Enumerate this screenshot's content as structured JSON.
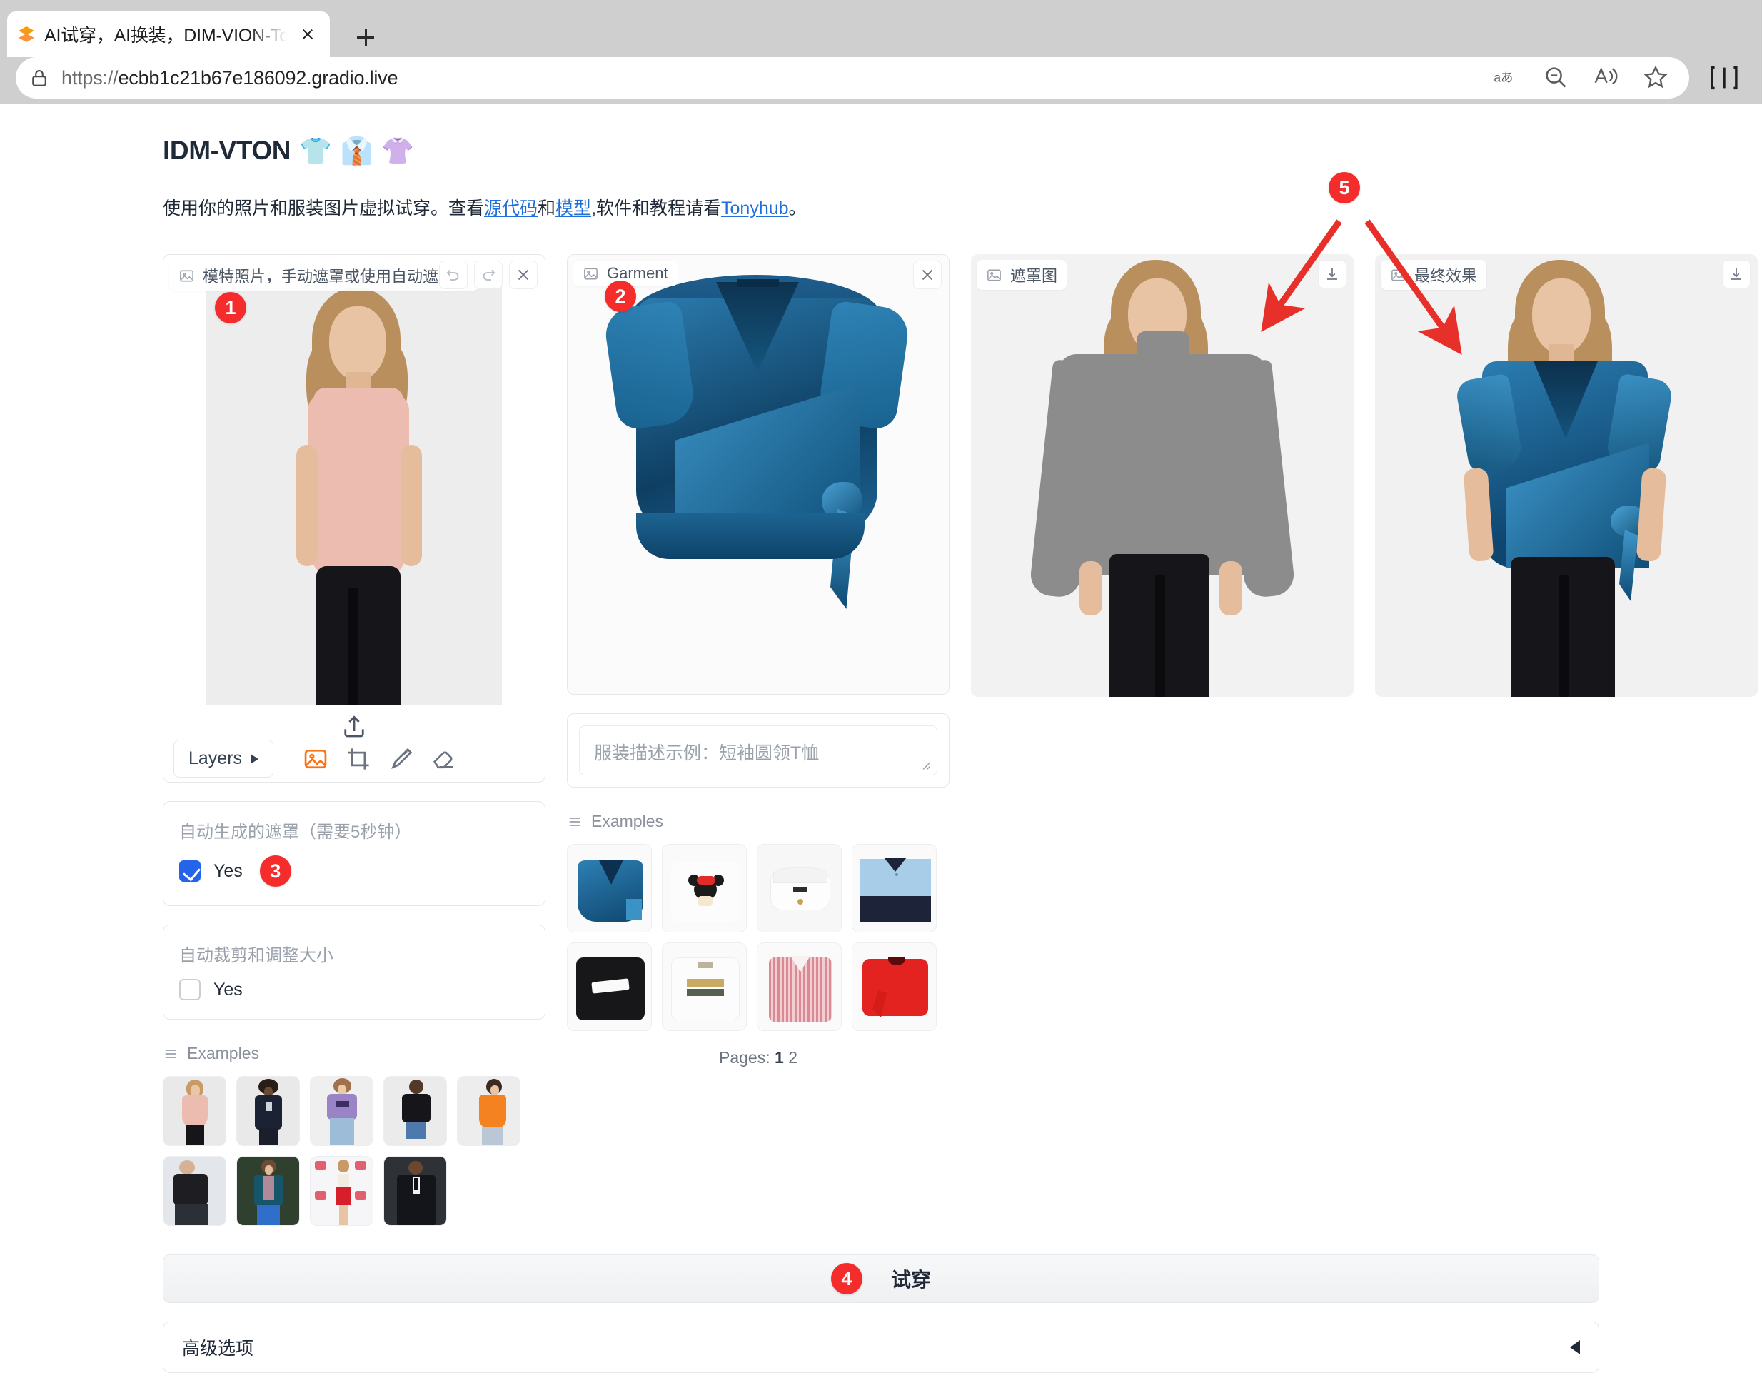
{
  "browser": {
    "tab": {
      "title": "AI试穿，AI换装，DIM-VION-Ton",
      "favicon": "gradio-logo-icon"
    },
    "new_tab_label": "+",
    "url": "https://ecbb1c21b67e186092.gradio.live",
    "url_scheme": "https://",
    "url_host": "ecbb1c21b67e186092.gradio.live",
    "toolbar_icons": [
      "translate-icon",
      "zoom-out-icon",
      "read-aloud-icon",
      "favorite-star-icon",
      "split-screen-icon"
    ]
  },
  "header": {
    "title": "IDM-VTON",
    "title_emojis": [
      "👕",
      "👔",
      "👚"
    ],
    "description_parts": {
      "lead": "使用你的照片和服装图片虚拟试穿。查看",
      "link_source": "源代码",
      "mid1": "和",
      "link_model": "模型",
      "mid2": ",软件和教程请看",
      "link_tonyhub": "Tonyhub",
      "tail": "。"
    }
  },
  "model_panel": {
    "label": "模特照片，手动遮罩或使用自动遮罩。",
    "icon": "picture-icon",
    "tools": [
      "undo-icon",
      "redo-icon",
      "close-icon"
    ],
    "editor": {
      "upload_icon": "upload-icon",
      "layers_label": "Layers",
      "tools": [
        "image-tool-icon",
        "crop-tool-icon",
        "brush-tool-icon",
        "eraser-tool-icon"
      ],
      "active_tool": "image-tool-icon"
    },
    "auto_mask": {
      "label": "自动生成的遮罩（需要5秒钟）",
      "checkbox_label": "Yes",
      "checked": true
    },
    "auto_crop": {
      "label": "自动裁剪和调整大小",
      "checkbox_label": "Yes",
      "checked": false
    },
    "examples": {
      "label": "Examples",
      "icon": "list-icon",
      "items": [
        "model-pink-sleeveless-blouse",
        "model-navy-long-sleeve-tee",
        "model-purple-graphic-tee",
        "model-black-tee-denim-shorts",
        "model-orange-cami",
        "man-black-leather-jacket",
        "man-teal-cardigan",
        "woman-white-top-red-skirt",
        "man-black-tuxedo-suit"
      ]
    }
  },
  "garment_panel": {
    "label": "Garment",
    "icon": "picture-icon",
    "tools": [
      "close-icon"
    ],
    "image": "blue-velvet-wrap-top",
    "prompt": {
      "value": "",
      "placeholder": "服装描述示例：短袖圆领T恤"
    },
    "examples": {
      "label": "Examples",
      "icon": "list-icon",
      "items": [
        "blue-velvet-wrap-top",
        "white-minnie-mouse-tee",
        "white-corset-top",
        "light-blue-navy-polo",
        "black-stussy-tee",
        "white-gucci-logo-tee",
        "pink-checked-shirt",
        "red-wrap-tee"
      ],
      "pages_label": "Pages:",
      "pages": [
        "1",
        "2"
      ],
      "active_page": "1"
    }
  },
  "mask_panel": {
    "label": "遮罩图",
    "icon": "picture-icon",
    "tools": [
      "download-icon"
    ],
    "image": "masked-model-gray-region"
  },
  "result_panel": {
    "label": "最终效果",
    "icon": "picture-icon",
    "tools": [
      "download-icon"
    ],
    "image": "model-wearing-blue-velvet-top"
  },
  "actions": {
    "tryon_label": "试穿",
    "advanced_label": "高级选项",
    "advanced_caret": "caret-left-icon"
  },
  "annotations": {
    "markers": [
      {
        "id": "1",
        "target": "model-photo-upload"
      },
      {
        "id": "2",
        "target": "garment-photo"
      },
      {
        "id": "3",
        "target": "auto-mask-checkbox"
      },
      {
        "id": "4",
        "target": "tryon-button"
      },
      {
        "id": "5",
        "target": "output-panels"
      }
    ],
    "marker_color": "#f42c2c",
    "arrow_color": "#e8302a"
  }
}
